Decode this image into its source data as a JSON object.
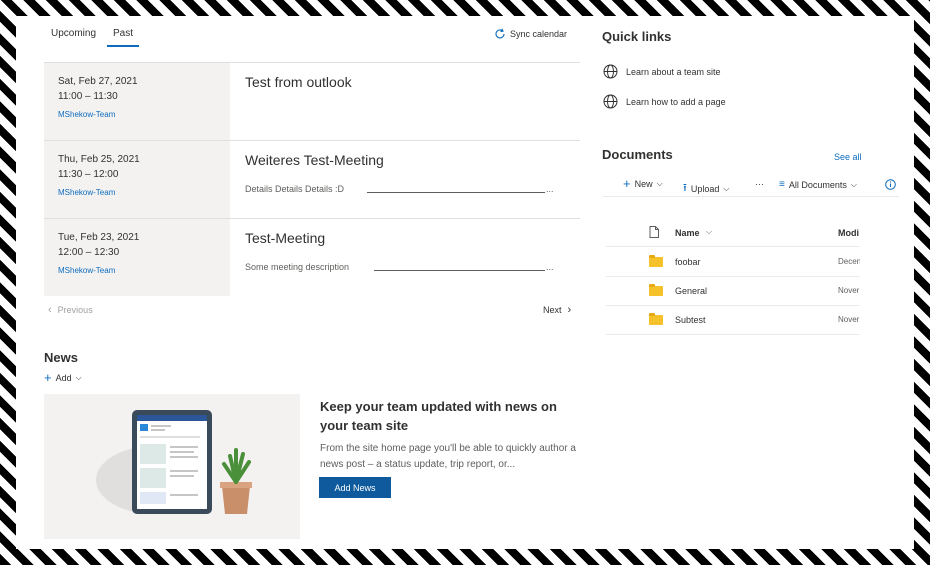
{
  "events": {
    "tabs": [
      "Upcoming",
      "Past"
    ],
    "sync_label": "Sync calendar",
    "items": [
      {
        "date": "Sat, Feb 27, 2021",
        "time": "11:00 – 11:30",
        "organizer": "MShekow-Team",
        "title": "Test from outlook",
        "description": ""
      },
      {
        "date": "Thu, Feb 25, 2021",
        "time": "11:30 – 12:00",
        "organizer": "MShekow-Team",
        "title": "Weiteres Test-Meeting",
        "description": "Details Details Details :D"
      },
      {
        "date": "Tue, Feb 23, 2021",
        "time": "12:00 – 12:30",
        "organizer": "MShekow-Team",
        "title": "Test-Meeting",
        "description": "Some meeting description"
      }
    ],
    "ellipsis": "...",
    "previous_label": "Previous",
    "next_label": "Next"
  },
  "news": {
    "title": "News",
    "add_label": "Add",
    "headline": "Keep your team updated with news on your team site",
    "body": "From the site home page you'll be able to quickly author a news post – a status update, trip report, or...",
    "button_label": "Add News"
  },
  "quick_links": {
    "title": "Quick links",
    "items": [
      "Learn about a team site",
      "Learn how to add a page"
    ]
  },
  "documents": {
    "title": "Documents",
    "see_all": "See all",
    "commands": {
      "new": "New",
      "upload": "Upload",
      "more": "···",
      "view": "All Documents"
    },
    "columns": {
      "name": "Name",
      "modified": "Modi"
    },
    "rows": [
      {
        "name": "foobar",
        "modified": "Decen"
      },
      {
        "name": "General",
        "modified": "Nover"
      },
      {
        "name": "Subtest",
        "modified": "Nover"
      }
    ]
  },
  "colors": {
    "accent": "#0f6cbd",
    "button": "#0f5a9c",
    "folder": "#f5c22b"
  }
}
